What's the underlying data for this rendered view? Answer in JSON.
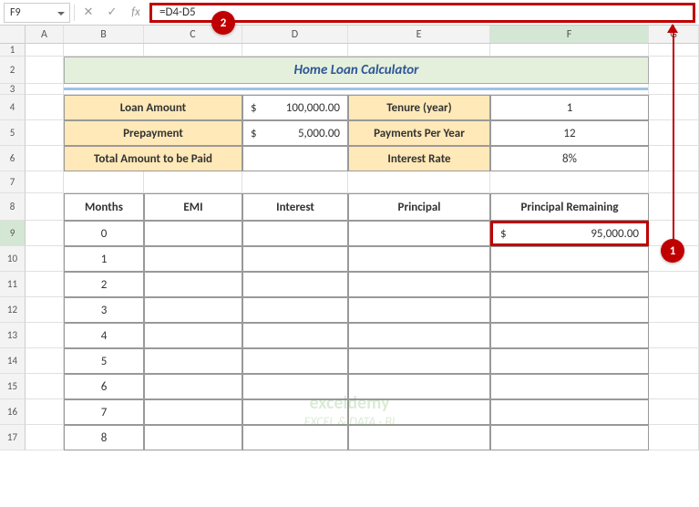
{
  "nameBox": "F9",
  "formula": "=D4-D5",
  "columns": [
    "A",
    "B",
    "C",
    "D",
    "E",
    "F",
    "G"
  ],
  "rowNumbers": [
    "1",
    "2",
    "3",
    "4",
    "5",
    "6",
    "7",
    "8",
    "9",
    "10",
    "11",
    "12",
    "13",
    "14",
    "15",
    "16",
    "17"
  ],
  "title": "Home Loan Calculator",
  "params": {
    "loanAmountLabel": "Loan Amount",
    "loanAmountCurrency": "$",
    "loanAmountValue": "100,000.00",
    "prepaymentLabel": "Prepayment",
    "prepaymentCurrency": "$",
    "prepaymentValue": "5,000.00",
    "totalLabel": "Total Amount to be Paid",
    "tenureLabel": "Tenure (year)",
    "tenureValue": "1",
    "paymentsLabel": "Payments Per Year",
    "paymentsValue": "12",
    "rateLabel": "Interest Rate",
    "rateValue": "8%"
  },
  "tableHeaders": {
    "months": "Months",
    "emi": "EMI",
    "interest": "Interest",
    "principal": "Principal",
    "remaining": "Principal Remaining"
  },
  "months": [
    "0",
    "1",
    "2",
    "3",
    "4",
    "5",
    "6",
    "7",
    "8"
  ],
  "selectedCell": {
    "currency": "$",
    "value": "95,000.00"
  },
  "callouts": {
    "one": "1",
    "two": "2"
  },
  "icons": {
    "cancel": "✕",
    "enter": "✓",
    "fx": "fx"
  },
  "watermark": {
    "brand": "exceldemy",
    "tag": "EXCEL & DATA · BI"
  },
  "chart_data": {
    "type": "table",
    "title": "Home Loan Calculator",
    "inputs": {
      "Loan Amount": 100000.0,
      "Prepayment": 5000.0,
      "Total Amount to be Paid": null,
      "Tenure (year)": 1,
      "Payments Per Year": 12,
      "Interest Rate": 0.08
    },
    "schedule_columns": [
      "Months",
      "EMI",
      "Interest",
      "Principal",
      "Principal Remaining"
    ],
    "schedule_rows": [
      {
        "Months": 0,
        "EMI": null,
        "Interest": null,
        "Principal": null,
        "Principal Remaining": 95000.0
      },
      {
        "Months": 1,
        "EMI": null,
        "Interest": null,
        "Principal": null,
        "Principal Remaining": null
      },
      {
        "Months": 2,
        "EMI": null,
        "Interest": null,
        "Principal": null,
        "Principal Remaining": null
      },
      {
        "Months": 3,
        "EMI": null,
        "Interest": null,
        "Principal": null,
        "Principal Remaining": null
      },
      {
        "Months": 4,
        "EMI": null,
        "Interest": null,
        "Principal": null,
        "Principal Remaining": null
      },
      {
        "Months": 5,
        "EMI": null,
        "Interest": null,
        "Principal": null,
        "Principal Remaining": null
      },
      {
        "Months": 6,
        "EMI": null,
        "Interest": null,
        "Principal": null,
        "Principal Remaining": null
      },
      {
        "Months": 7,
        "EMI": null,
        "Interest": null,
        "Principal": null,
        "Principal Remaining": null
      },
      {
        "Months": 8,
        "EMI": null,
        "Interest": null,
        "Principal": null,
        "Principal Remaining": null
      }
    ],
    "formula_shown": "=D4-D5",
    "active_cell": "F9"
  }
}
